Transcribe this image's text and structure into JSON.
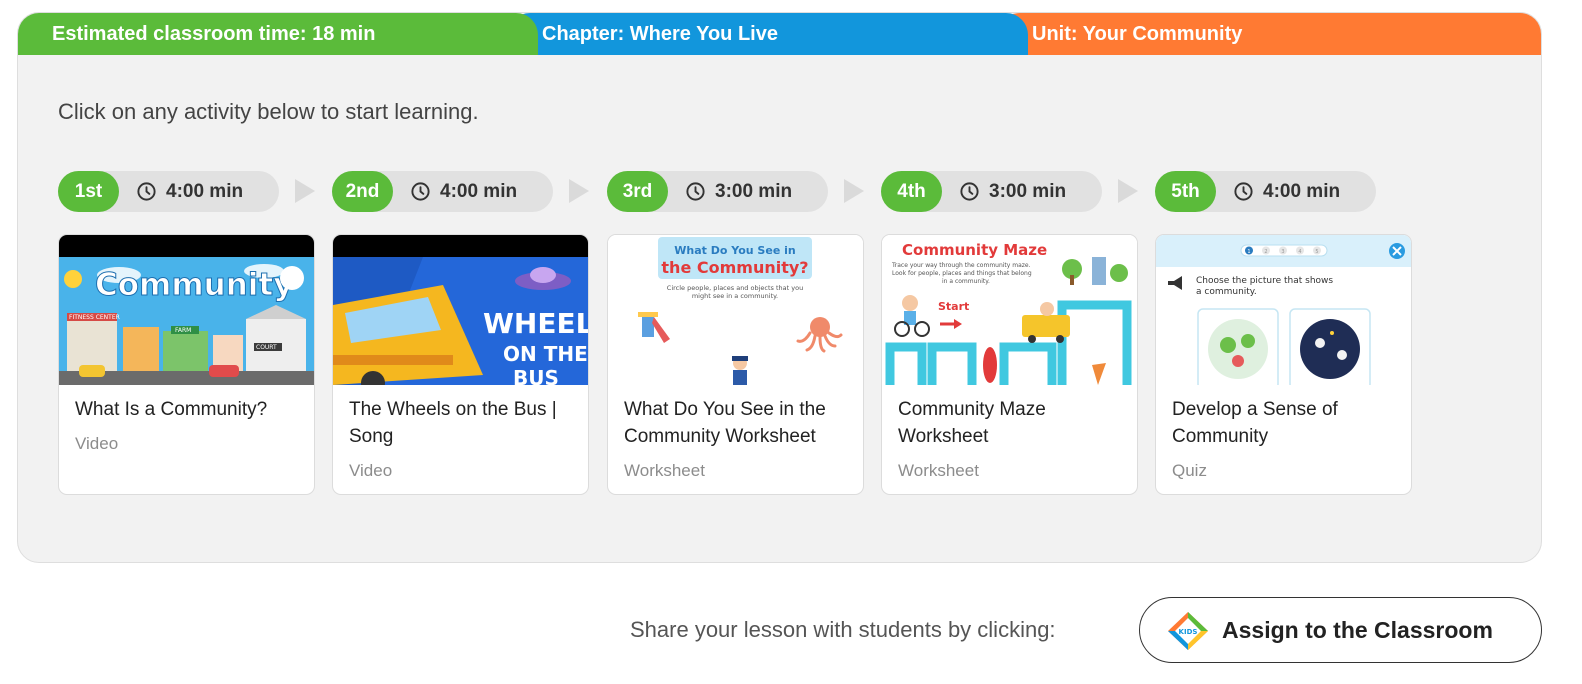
{
  "header": {
    "time_label": "Estimated classroom time: 18 min",
    "chapter_label": "Chapter: Where You Live",
    "unit_label": "Unit: Your Community",
    "colors": {
      "time": "#5bbb3a",
      "chapter": "#1296dc",
      "unit": "#ff7a33"
    }
  },
  "intro_text": "Click on any activity below to start learning.",
  "steps": [
    {
      "order": "1st",
      "duration": "4:00 min"
    },
    {
      "order": "2nd",
      "duration": "4:00 min"
    },
    {
      "order": "3rd",
      "duration": "3:00 min"
    },
    {
      "order": "4th",
      "duration": "3:00 min"
    },
    {
      "order": "5th",
      "duration": "4:00 min"
    }
  ],
  "activities": [
    {
      "title": "What Is a Community?",
      "type": "Video",
      "thumb_text": "Community",
      "thumb_sign_1": "FITNESS CENTER",
      "thumb_sign_2": "FARM",
      "thumb_sign_3": "COURT"
    },
    {
      "title": "The Wheels on the Bus | Song",
      "type": "Video",
      "thumb_line_1": "WHEELS",
      "thumb_line_2": "ON THE",
      "thumb_line_3": "BUS"
    },
    {
      "title": "What Do You See in the Community Worksheet",
      "type": "Worksheet",
      "thumb_heading_1": "What Do You See in",
      "thumb_heading_2": "the Community?",
      "thumb_instr_1": "Circle people, places and objects that you",
      "thumb_instr_2": "might see in a community."
    },
    {
      "title": "Community Maze Worksheet",
      "type": "Worksheet",
      "thumb_heading": "Community Maze",
      "thumb_instr_1": "Trace your way through the community maze.",
      "thumb_instr_2": "Look for people, places and things that belong",
      "thumb_instr_3": "in a community.",
      "thumb_start": "Start"
    },
    {
      "title": "Develop a Sense of Community",
      "type": "Quiz",
      "thumb_prompt_1": "Choose the picture that shows",
      "thumb_prompt_2": "a community.",
      "progress_labels": [
        "1",
        "2",
        "3",
        "4",
        "5"
      ]
    }
  ],
  "footer": {
    "share_text": "Share your lesson with students by clicking:",
    "assign_label": "Assign to the Classroom",
    "logo_text": "KIDS"
  },
  "icons": {
    "clock": "clock-icon",
    "arrow": "chevron-right-icon",
    "logo": "kids-academy-logo-icon"
  }
}
